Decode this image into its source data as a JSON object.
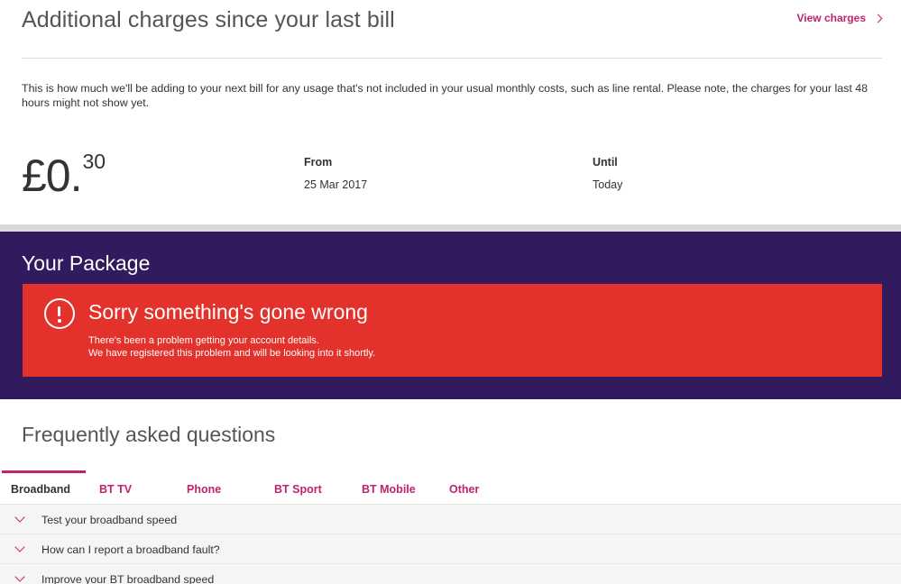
{
  "charges": {
    "title": "Additional charges since your last bill",
    "view_link": "View charges",
    "description": "This is how much we'll be adding to your next bill for any usage that's not included in your usual monthly costs, such as line rental. Please note, the charges for your last 48 hours might not show yet.",
    "amount_pounds": "£0.",
    "amount_pence": "30",
    "from_label": "From",
    "from_value": "25 Mar 2017",
    "until_label": "Until",
    "until_value": "Today"
  },
  "package": {
    "title": "Your Package",
    "error_title": "Sorry something's gone wrong",
    "error_line1": "There's been a problem getting your account details.",
    "error_line2": "We have registered this problem and will be looking into it shortly."
  },
  "faq": {
    "title": "Frequently asked questions",
    "tabs": [
      {
        "label": "Broadband",
        "active": true
      },
      {
        "label": "BT TV",
        "active": false
      },
      {
        "label": "Phone",
        "active": false
      },
      {
        "label": "BT Sport",
        "active": false
      },
      {
        "label": "BT Mobile",
        "active": false
      },
      {
        "label": "Other",
        "active": false
      }
    ],
    "questions": [
      "Test your broadband speed",
      "How can I report a broadband fault?",
      "Improve your BT broadband speed"
    ]
  },
  "colors": {
    "accent": "#c0226f",
    "package_bg": "#321a5e",
    "error_bg": "#e3312b"
  },
  "icons": {
    "view_charges": "chevron-right-icon",
    "error": "exclamation-circle-icon",
    "faq_item": "chevron-down-icon"
  }
}
